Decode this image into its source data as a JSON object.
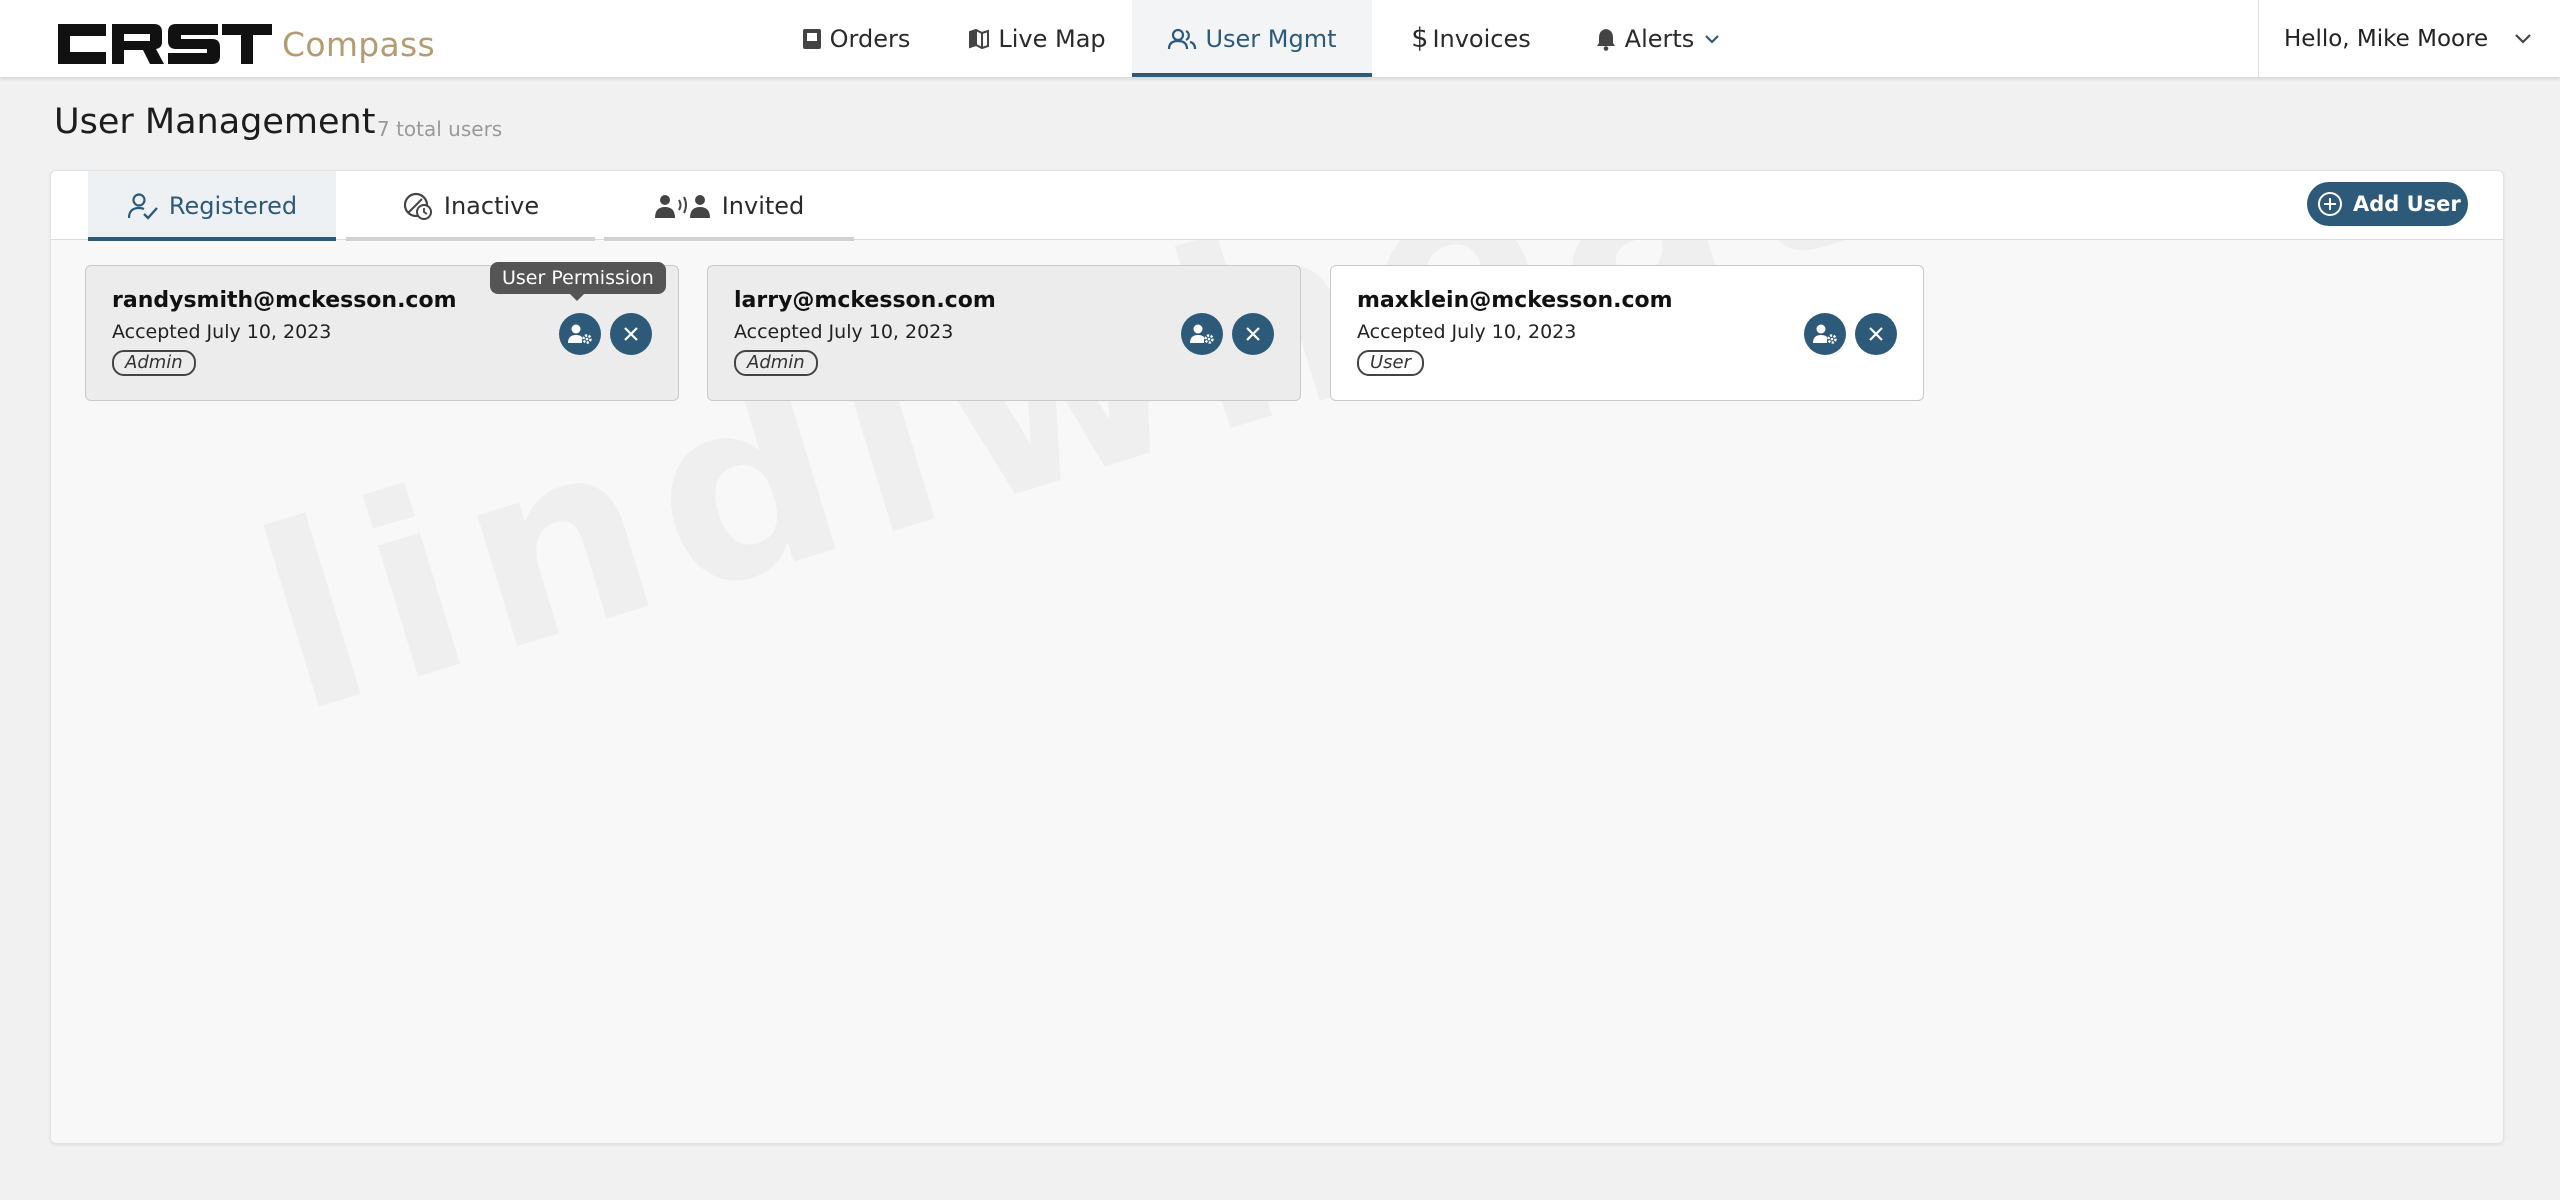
{
  "brand": {
    "logo_text": "CRST",
    "product": "Compass"
  },
  "nav": {
    "items": [
      {
        "label": "Orders",
        "icon": "orders-icon"
      },
      {
        "label": "Live Map",
        "icon": "map-icon"
      },
      {
        "label": "User Mgmt",
        "icon": "users-icon",
        "active": true
      },
      {
        "label": "Invoices",
        "icon": "dollar-icon"
      },
      {
        "label": "Alerts",
        "icon": "bell-icon"
      }
    ]
  },
  "user_menu": {
    "greeting": "Hello, Mike Moore"
  },
  "page": {
    "title": "User Management",
    "count": "7 total users"
  },
  "tabs": [
    {
      "label": "Registered",
      "icon": "user-check-icon",
      "active": true
    },
    {
      "label": "Inactive",
      "icon": "inactive-icon"
    },
    {
      "label": "Invited",
      "icon": "invited-icon"
    }
  ],
  "add_user": {
    "label": "Add User"
  },
  "tooltip": {
    "text": "User Permission"
  },
  "watermark": "lindiwheaton.com",
  "users": [
    {
      "email": "randysmith@mckesson.com",
      "status": "Accepted July 10, 2023",
      "role": "Admin"
    },
    {
      "email": "larry@mckesson.com",
      "status": "Accepted July 10, 2023",
      "role": "Admin"
    },
    {
      "email": "maxklein@mckesson.com",
      "status": "Accepted July 10, 2023",
      "role": "User"
    }
  ],
  "colors": {
    "accent": "#2e5a7a",
    "brand_gold": "#b49b72"
  }
}
